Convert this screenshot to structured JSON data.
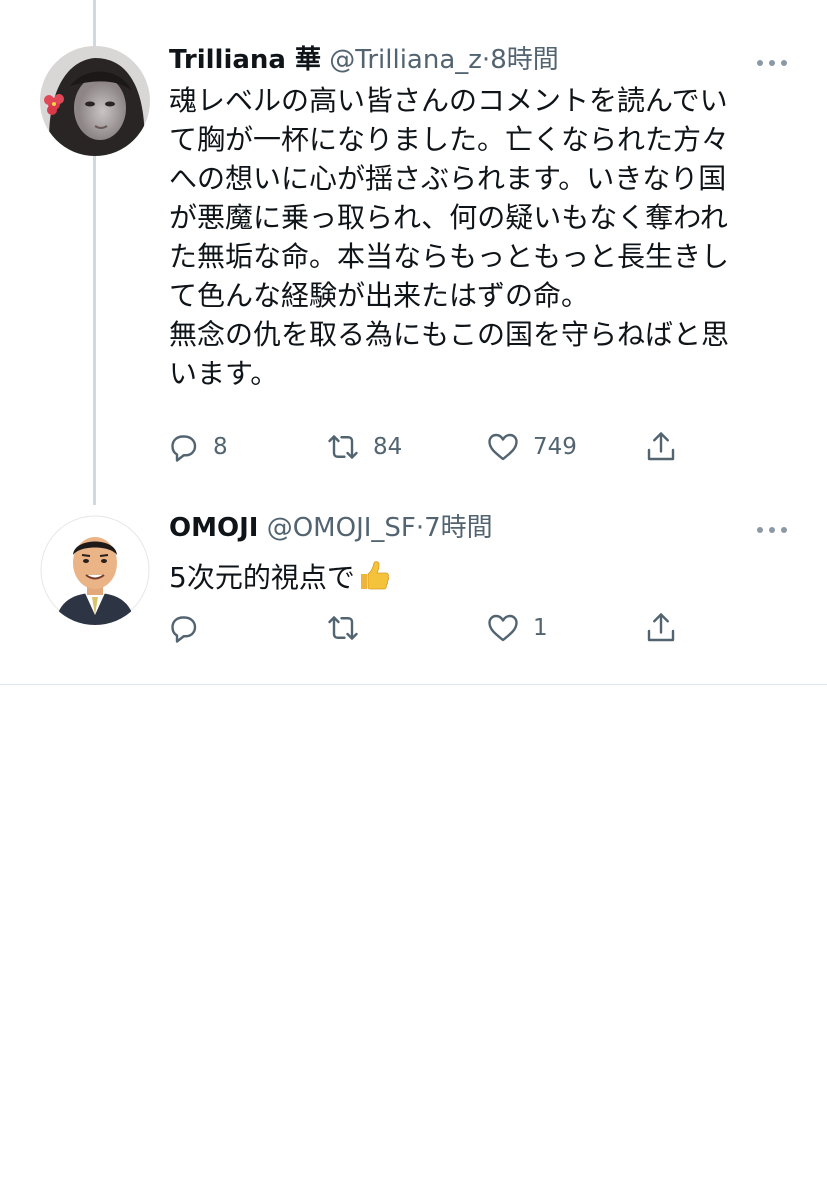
{
  "tweets": [
    {
      "name": "Trilliana 華",
      "handle": "@Trilliana_z",
      "separator": "·",
      "time": "8時間",
      "lines": [
        "魂レベルの高い皆さんのコメントを読んでい",
        "て胸が一杯になりました。亡くなられた方々",
        "への想いに心が揺さぶられます。いきなり国",
        "が悪魔に乗っ取られ、何の疑いもなく奪われ",
        "た無垢な命。本当ならもっともっと長生きし",
        "て色んな経験が出来たはずの命。",
        "無念の仇を取る為にもこの国を守らねばと思",
        "います。"
      ],
      "reply_count": "8",
      "retweet_count": "84",
      "like_count": "749"
    },
    {
      "name": "OMOJI",
      "handle": "@OMOJI_SF",
      "separator": "·",
      "time": "7時間",
      "text": "5次元的視点で",
      "emoji": "thumbs-up",
      "reply_count": "",
      "retweet_count": "",
      "like_count": "1"
    }
  ],
  "colors": {
    "text": "#0f1419",
    "secondary": "#536471",
    "thread_line": "#cfd9de",
    "emoji_yellow": "#f5c33b"
  }
}
